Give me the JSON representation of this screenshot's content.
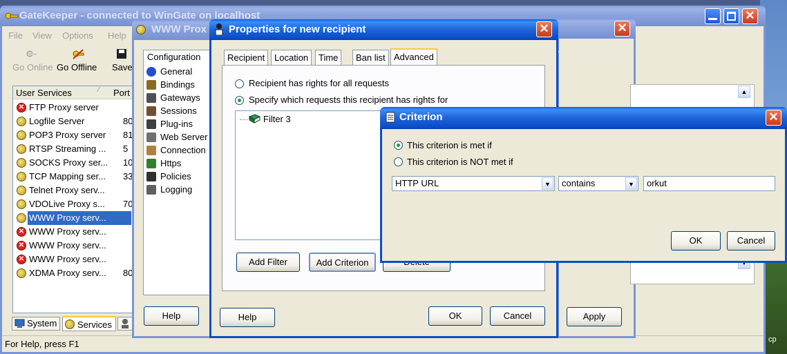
{
  "gatekeeper": {
    "title": "GateKeeper - connected to WinGate on localhost",
    "menu": [
      "File",
      "View",
      "Options",
      "Help"
    ],
    "toolbar": {
      "go_online": "Go Online",
      "go_offline": "Go Offline",
      "save": "Save"
    },
    "columns": {
      "user_services": "User Services",
      "port": "Port"
    },
    "services": [
      {
        "name": "FTP Proxy server",
        "port": "",
        "status": "error"
      },
      {
        "name": "Logfile Server",
        "port": "80",
        "status": "ok"
      },
      {
        "name": "POP3 Proxy server",
        "port": "81",
        "status": "ok"
      },
      {
        "name": "RTSP Streaming ...",
        "port": "5",
        "status": "ok"
      },
      {
        "name": "SOCKS Proxy ser...",
        "port": "10",
        "status": "ok"
      },
      {
        "name": "TCP Mapping ser...",
        "port": "33",
        "status": "ok"
      },
      {
        "name": "Telnet Proxy serv...",
        "port": "",
        "status": "ok"
      },
      {
        "name": "VDOLive Proxy s...",
        "port": "70",
        "status": "ok"
      },
      {
        "name": "WWW Proxy serv...",
        "port": "",
        "status": "ok",
        "selected": true
      },
      {
        "name": "WWW Proxy serv...",
        "port": "",
        "status": "error"
      },
      {
        "name": "WWW Proxy serv...",
        "port": "",
        "status": "error"
      },
      {
        "name": "WWW Proxy serv...",
        "port": "",
        "status": "error"
      },
      {
        "name": "XDMA Proxy serv...",
        "port": "80",
        "status": "ok"
      }
    ],
    "bottom_tabs": {
      "system": "System",
      "services": "Services"
    },
    "status_bar": "For Help, press F1"
  },
  "www_proxy": {
    "title": "WWW Prox",
    "config_header": "Configuration",
    "config_items": [
      "General",
      "Bindings",
      "Gateways",
      "Sessions",
      "Plug-ins",
      "Web Server",
      "Connection",
      "Https",
      "Policies",
      "Logging"
    ],
    "help": "Help"
  },
  "properties": {
    "title": "Properties for new recipient",
    "tabs": [
      "Recipient",
      "Location",
      "Time",
      "Ban list",
      "Advanced"
    ],
    "radio_all": "Recipient has rights for all requests",
    "radio_specific": "Specify which requests this recipient has rights for",
    "tree_item": "Filter 3",
    "add_filter": "Add Filter",
    "add_criterion": "Add Criterion",
    "delete": "Delete",
    "help": "Help",
    "ok": "OK",
    "cancel": "Cancel"
  },
  "back_dialog": {
    "apply": "Apply"
  },
  "criterion": {
    "title": "Criterion",
    "met": "This criterion is met if",
    "not_met": "This criterion is NOT met if",
    "field_value": "HTTP URL",
    "operator_value": "contains",
    "text_value": "orkut",
    "ok": "OK",
    "cancel": "Cancel"
  },
  "desktop": {
    "corner_text": "cp"
  }
}
